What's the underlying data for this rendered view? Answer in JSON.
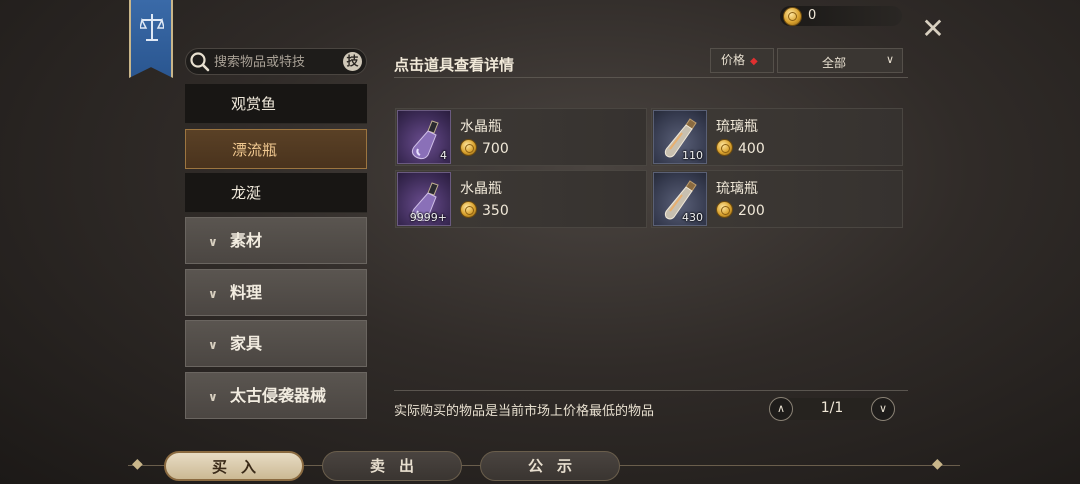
{
  "header": {
    "coin_balance": "0",
    "close_label": "✕"
  },
  "search": {
    "placeholder": "搜索物品或特技",
    "badge": "技"
  },
  "sidebar": {
    "subitems": [
      {
        "label": "观赏鱼",
        "active": false
      },
      {
        "label": "漂流瓶",
        "active": true
      },
      {
        "label": "龙涎",
        "active": false
      }
    ],
    "categories": [
      {
        "label": "素材"
      },
      {
        "label": "料理"
      },
      {
        "label": "家具"
      },
      {
        "label": "太古侵袭器械"
      }
    ]
  },
  "main": {
    "title": "点击道具查看详情",
    "sort_label": "价格",
    "filter_value": "全部",
    "items": [
      {
        "name": "水晶瓶",
        "price": "700",
        "qty": "4",
        "icon": "crystal-bottle-icon"
      },
      {
        "name": "琉璃瓶",
        "price": "400",
        "qty": "110",
        "icon": "glass-bottle-icon"
      },
      {
        "name": "水晶瓶",
        "price": "350",
        "qty": "9999+",
        "icon": "crystal-bottle-icon"
      },
      {
        "name": "琉璃瓶",
        "price": "200",
        "qty": "430",
        "icon": "glass-bottle-icon"
      }
    ],
    "note": "实际购买的物品是当前市场上价格最低的物品",
    "page": "1/1"
  },
  "tabs": [
    {
      "label": "买入",
      "active": true
    },
    {
      "label": "卖出",
      "active": false
    },
    {
      "label": "公示",
      "active": false
    }
  ],
  "colors": {
    "accent": "#9c7540",
    "banner": "#2a5690",
    "coin": "#d9a22e"
  }
}
